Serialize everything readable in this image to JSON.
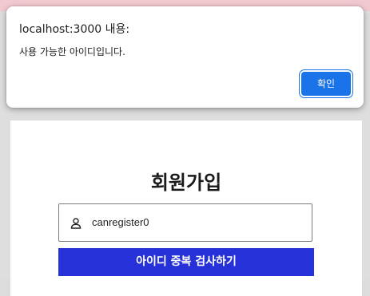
{
  "dialog": {
    "title": "localhost:3000 내용:",
    "message": "사용 가능한 아이디입니다.",
    "ok_label": "확인"
  },
  "signup": {
    "title": "회원가입",
    "id_field_value": "canregister0",
    "check_button_label": "아이디 중복 검사하기"
  },
  "icons": {
    "id_field": "person-icon"
  },
  "colors": {
    "accent": "#2631d9",
    "dialog_button": "#1a73e8"
  }
}
